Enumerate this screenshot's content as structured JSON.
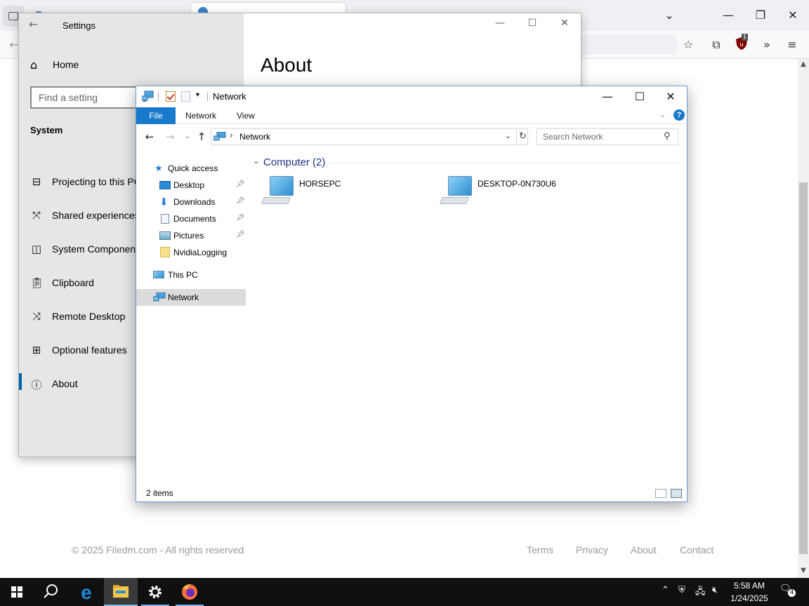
{
  "browser": {
    "footer_copyright": "© 2025 Filedm.com - All rights reserved",
    "footer_links": [
      "Terms",
      "Privacy",
      "About",
      "Contact"
    ],
    "extension_badge": "1"
  },
  "settings": {
    "window_title": "Settings",
    "home_label": "Home",
    "search_placeholder": "Find a setting",
    "section_label": "System",
    "nav_items": [
      {
        "label": "Projecting to this PC",
        "icon": "projector-icon"
      },
      {
        "label": "Shared experiences",
        "icon": "share-icon"
      },
      {
        "label": "System Components",
        "icon": "components-icon"
      },
      {
        "label": "Clipboard",
        "icon": "clipboard-icon"
      },
      {
        "label": "Remote Desktop",
        "icon": "remote-desktop-icon"
      },
      {
        "label": "Optional features",
        "icon": "features-icon"
      },
      {
        "label": "About",
        "icon": "info-icon"
      }
    ],
    "page_heading": "About"
  },
  "explorer": {
    "window_title": "Network",
    "ribbon_tabs": [
      "File",
      "Network",
      "View"
    ],
    "address": "Network",
    "search_placeholder": "Search Network",
    "nav_pane": {
      "quick_access": "Quick access",
      "pinned": [
        "Desktop",
        "Downloads",
        "Documents",
        "Pictures"
      ],
      "folders": [
        "NvidiaLogging"
      ],
      "this_pc": "This PC",
      "network": "Network"
    },
    "group_header": "Computer (2)",
    "computers": [
      "HORSEPC",
      "DESKTOP-0N730U6"
    ],
    "status": "2 items"
  },
  "taskbar": {
    "time": "5:58 AM",
    "date": "1/24/2025",
    "notification_count": "4"
  },
  "colors": {
    "accent": "#1979ca",
    "settings_sidebar": "#e6e6e6",
    "taskbar": "#101010"
  }
}
